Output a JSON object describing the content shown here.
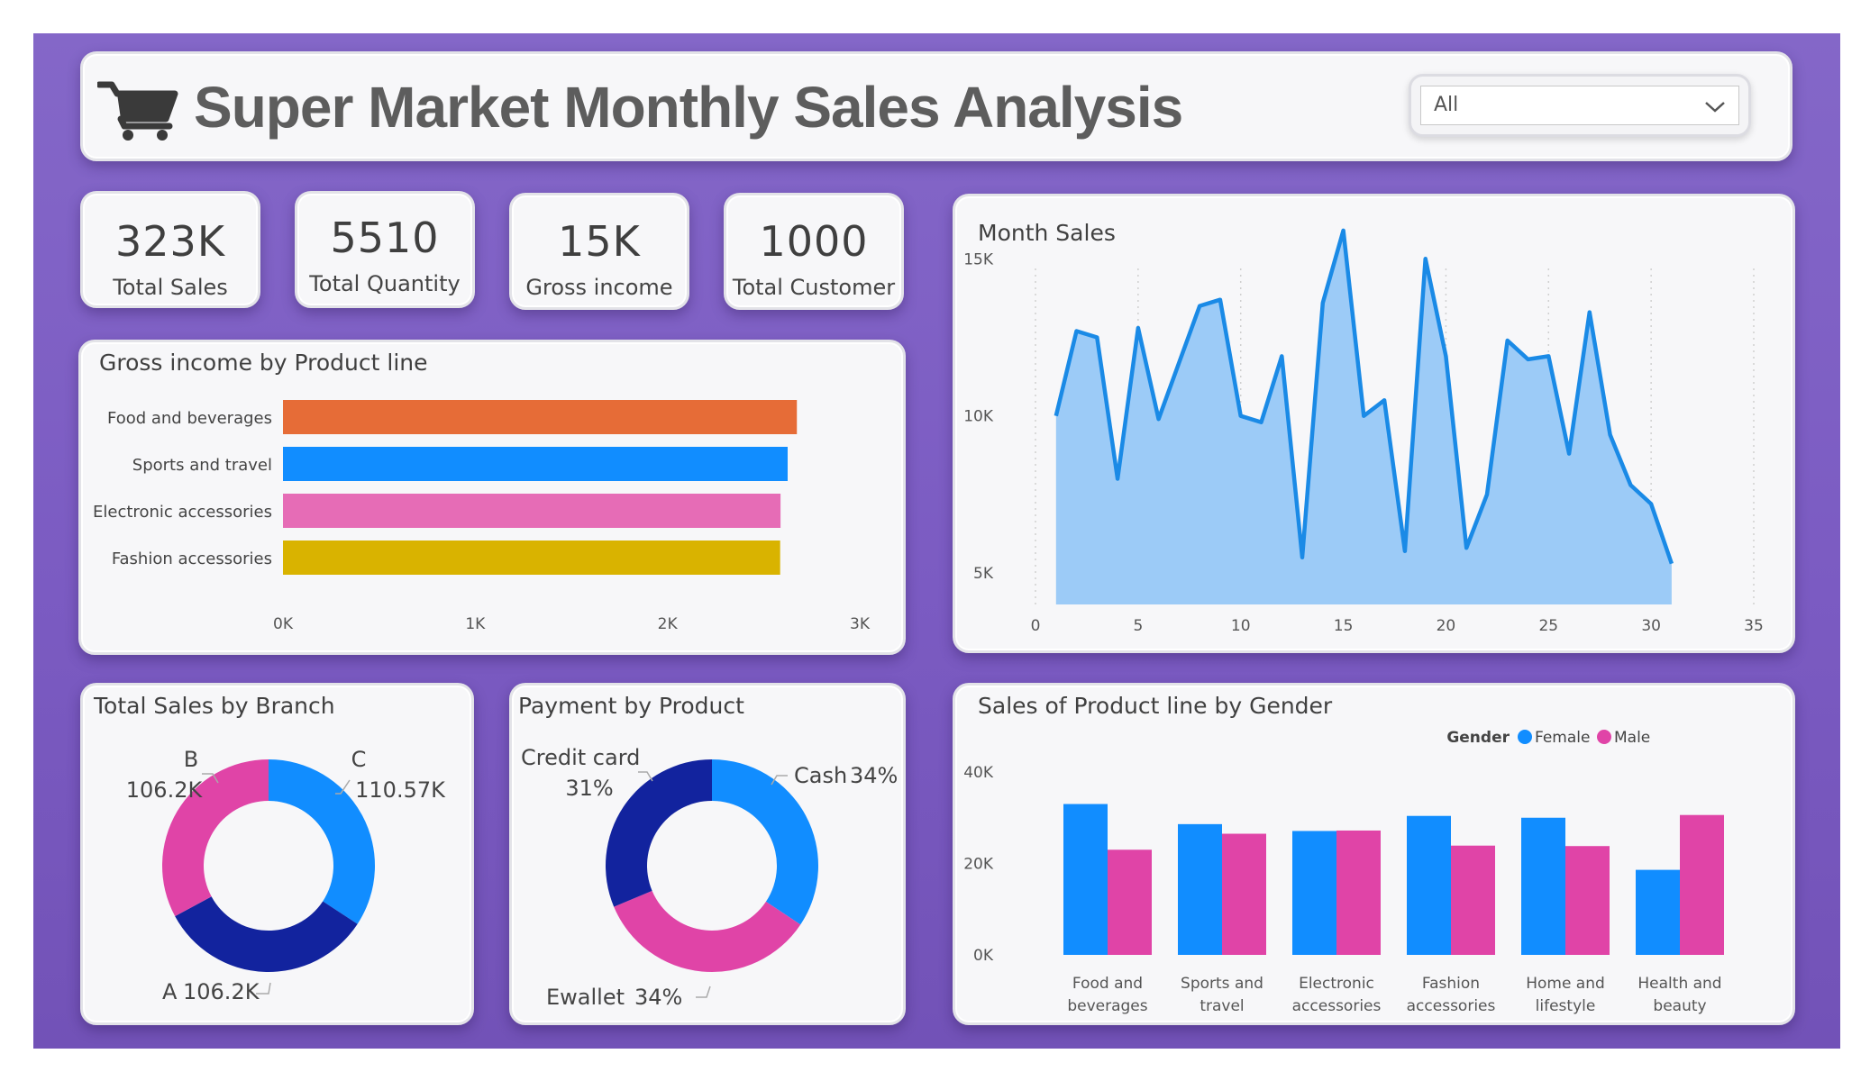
{
  "header": {
    "title": "Super Market Monthly Sales Analysis",
    "icon": "shopping-cart-icon",
    "filter": {
      "value": "All",
      "icon": "chevron-down-icon"
    }
  },
  "kpis": [
    {
      "value": "323K",
      "label": "Total Sales"
    },
    {
      "value": "5510",
      "label": "Total Quantity"
    },
    {
      "value": "15K",
      "label": "Gross income"
    },
    {
      "value": "1000",
      "label": "Total Customer"
    }
  ],
  "colors": {
    "blue": "#118dff",
    "navy": "#12239e",
    "pink": "#e044a7",
    "orange": "#e66c37",
    "rose": "#e66cb6",
    "gold": "#d9b300",
    "area_fill": "#9ccbf7",
    "area_line": "#1a8ae6"
  },
  "chart_data": [
    {
      "type": "bar",
      "orientation": "horizontal",
      "title": "Gross income by Product line",
      "categories": [
        "Food and beverages",
        "Sports and travel",
        "Electronic accessories",
        "Fashion accessories"
      ],
      "values": [
        2673,
        2625,
        2588,
        2586
      ],
      "colors": [
        "#e66c37",
        "#118dff",
        "#e66cb6",
        "#d9b300"
      ],
      "xlim": [
        0,
        3000
      ],
      "xticks": [
        "0K",
        "1K",
        "2K",
        "3K"
      ]
    },
    {
      "type": "area",
      "title": "Month Sales",
      "x": [
        1,
        2,
        3,
        4,
        5,
        6,
        7,
        8,
        9,
        10,
        11,
        12,
        13,
        14,
        15,
        16,
        17,
        18,
        19,
        20,
        21,
        22,
        23,
        24,
        25,
        26,
        27,
        28,
        29,
        30,
        31
      ],
      "values": [
        10000,
        12700,
        12500,
        8000,
        12800,
        9900,
        11700,
        13500,
        13700,
        10000,
        9800,
        11900,
        5500,
        13600,
        15900,
        10000,
        10500,
        5700,
        15000,
        11900,
        5800,
        7500,
        12400,
        11800,
        11900,
        8800,
        13300,
        9400,
        7800,
        7200,
        5300
      ],
      "xlim": [
        0,
        35
      ],
      "ylim": [
        4000,
        16500
      ],
      "xticks": [
        "0",
        "5",
        "10",
        "15",
        "20",
        "25",
        "30",
        "35"
      ],
      "yticks": [
        "5K",
        "10K",
        "15K"
      ],
      "grid": "vertical dotted"
    },
    {
      "type": "pie",
      "donut": true,
      "title": "Total Sales by Branch",
      "slices": [
        {
          "label": "C",
          "display": "110.57K",
          "value": 110.57,
          "color": "#118dff"
        },
        {
          "label": "A",
          "display": "106.2K",
          "value": 106.2,
          "color": "#12239e"
        },
        {
          "label": "B",
          "display": "106.2K",
          "value": 106.2,
          "color": "#e044a7"
        }
      ]
    },
    {
      "type": "pie",
      "donut": true,
      "title": "Payment by Product",
      "slices": [
        {
          "label": "Cash",
          "display": "34%",
          "value": 34,
          "color": "#118dff"
        },
        {
          "label": "Ewallet",
          "display": "34%",
          "value": 34,
          "color": "#e044a7"
        },
        {
          "label": "Credit card",
          "display": "31%",
          "value": 31,
          "color": "#12239e"
        }
      ]
    },
    {
      "type": "bar",
      "title": "Sales of Product line by Gender",
      "legend_title": "Gender",
      "categories": [
        "Food and beverages",
        "Sports and travel",
        "Electronic accessories",
        "Fashion accessories",
        "Home and lifestyle",
        "Health and beauty"
      ],
      "series": [
        {
          "name": "Female",
          "color": "#118dff",
          "values": [
            33000,
            28600,
            27100,
            30400,
            30000,
            18600
          ]
        },
        {
          "name": "Male",
          "color": "#e044a7",
          "values": [
            23000,
            26500,
            27200,
            23900,
            23800,
            30600
          ]
        }
      ],
      "ylim": [
        0,
        40000
      ],
      "yticks": [
        "0K",
        "20K",
        "40K"
      ]
    }
  ]
}
